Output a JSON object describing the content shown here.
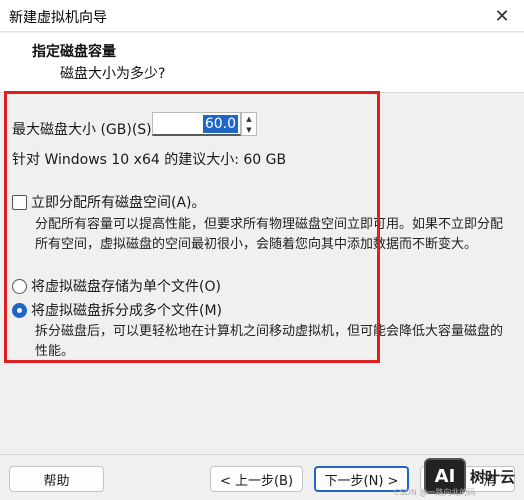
{
  "window": {
    "title": "新建虚拟机向导",
    "close_symbol": "✕"
  },
  "header": {
    "title": "指定磁盘容量",
    "subtitle": "磁盘大小为多少?"
  },
  "disk_size": {
    "label": "最大磁盘大小 (GB)(S):",
    "value": "60.0",
    "recommendation": "针对 Windows 10 x64 的建议大小: 60 GB"
  },
  "allocate": {
    "label": "立即分配所有磁盘空间(A)。",
    "checked": false,
    "description": "分配所有容量可以提高性能，但要求所有物理磁盘空间立即可用。如果不立即分配所有空间，虚拟磁盘的空间最初很小，会随着您向其中添加数据而不断变大。"
  },
  "storage_options": [
    {
      "label": "将虚拟磁盘存储为单个文件(O)",
      "selected": false
    },
    {
      "label": "将虚拟磁盘拆分成多个文件(M)",
      "selected": true
    }
  ],
  "split_description": "拆分磁盘后，可以更轻松地在计算机之间移动虚拟机，但可能会降低大容量磁盘的性能。",
  "buttons": {
    "help": "帮助",
    "back": "< 上一步(B)",
    "next": "下一步(N) >",
    "cancel": "消"
  },
  "watermark": {
    "logo": "AI",
    "text": "树叶云",
    "credit": "CSDN @一路向北的码"
  },
  "colors": {
    "accent": "#1f66c7",
    "highlight": "#e02020"
  }
}
